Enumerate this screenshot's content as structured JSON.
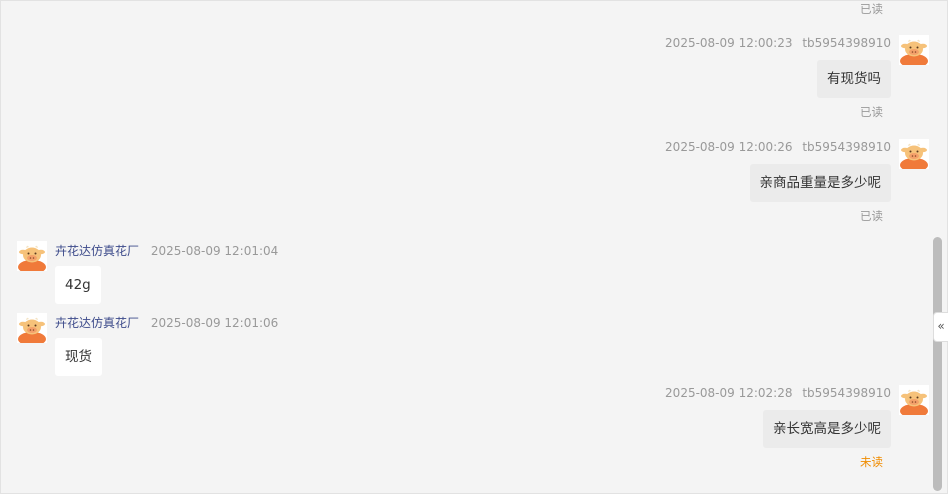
{
  "messages": [
    {
      "direction": "outgoing",
      "read_status": "已读"
    },
    {
      "direction": "outgoing",
      "timestamp": "2025-08-09 12:00:23",
      "sender": "tb5954398910",
      "text": "有现货吗",
      "read_status": "已读"
    },
    {
      "direction": "outgoing",
      "timestamp": "2025-08-09 12:00:26",
      "sender": "tb5954398910",
      "text": "亲商品重量是多少呢",
      "read_status": "已读"
    },
    {
      "direction": "incoming",
      "sender": "卉花达仿真花厂",
      "timestamp": "2025-08-09 12:01:04",
      "text": "42g"
    },
    {
      "direction": "incoming",
      "sender": "卉花达仿真花厂",
      "timestamp": "2025-08-09 12:01:06",
      "text": "现货"
    },
    {
      "direction": "outgoing",
      "timestamp": "2025-08-09 12:02:28",
      "sender": "tb5954398910",
      "text": "亲长宽高是多少呢",
      "read_status": "未读"
    }
  ],
  "collapse_toggle": {
    "icon": "double-chevron-left-icon",
    "glyph": "«"
  },
  "colors": {
    "shop_name": "#3c4a8a",
    "unread": "#f08c00",
    "panel_bg": "#f4f4f4"
  }
}
